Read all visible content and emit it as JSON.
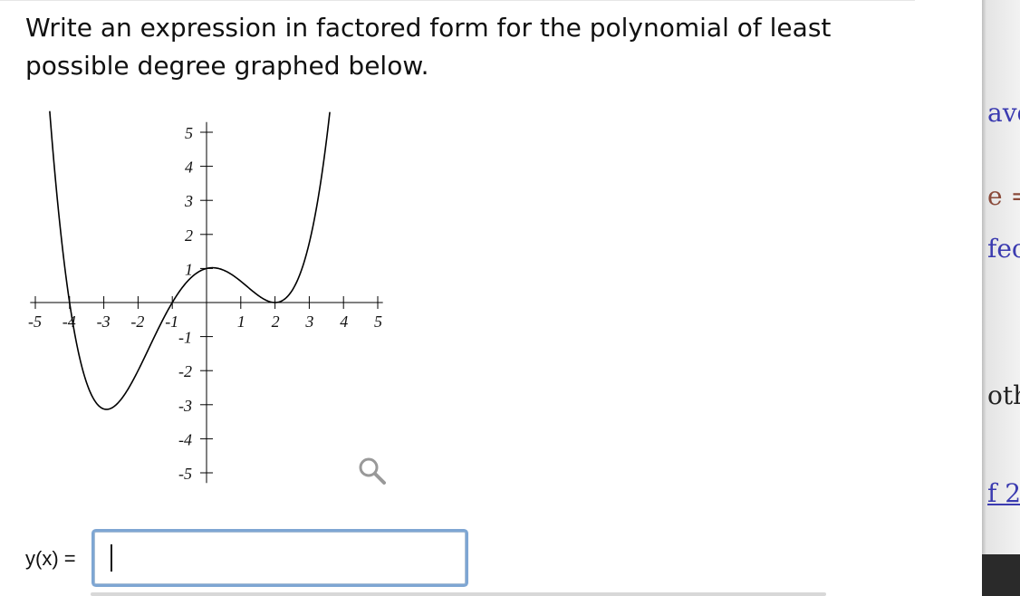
{
  "question": {
    "text": "Write an expression in factored form for the polynomial of least possible degree graphed below."
  },
  "graph": {
    "x_tick_labels": [
      "-5",
      "-4",
      "-3",
      "-2",
      "-1",
      "1",
      "2",
      "3",
      "4",
      "5"
    ],
    "y_tick_labels": [
      "5",
      "4",
      "3",
      "2",
      "1",
      "-1",
      "-2",
      "-3",
      "-4",
      "-5"
    ],
    "curve_color": "#000000",
    "axis_color": "#000000",
    "magnify_icon": "magnifying-glass-icon",
    "magnify_color": "#999999"
  },
  "answer": {
    "label": "y(x) =",
    "value": ""
  },
  "sidebar": {
    "fragments": [
      "ave",
      "e =",
      "fec",
      "oth",
      "f 2"
    ]
  }
}
